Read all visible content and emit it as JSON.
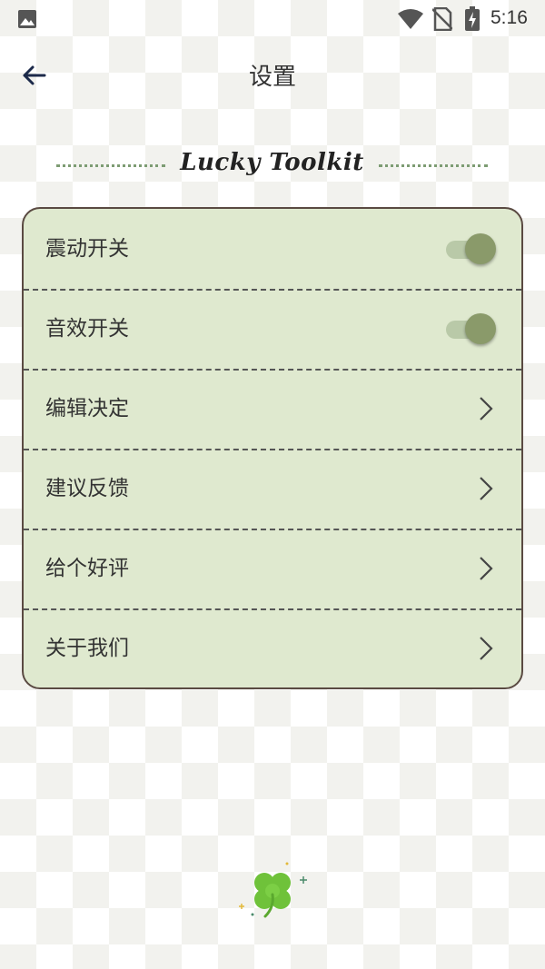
{
  "status_bar": {
    "time": "5:16",
    "icons": [
      "gallery-icon",
      "wifi-icon",
      "no-sim-icon",
      "battery-charging-icon"
    ]
  },
  "header": {
    "title": "设置",
    "back_icon": "arrow-left-icon"
  },
  "brand": {
    "text": "Lucky Toolkit"
  },
  "settings": {
    "vibration": {
      "label": "震动开关",
      "enabled": true
    },
    "sound": {
      "label": "音效开关",
      "enabled": true
    },
    "edit_decision": {
      "label": "编辑决定"
    },
    "feedback": {
      "label": "建议反馈"
    },
    "rate": {
      "label": "给个好评"
    },
    "about": {
      "label": "关于我们"
    }
  },
  "colors": {
    "card_bg": "#dfe9cf",
    "card_border": "#5a4a42",
    "toggle_thumb": "#8a9a6a",
    "toggle_track": "#b9c9a8",
    "clover": "#6fc23a",
    "accent_dots": "#7d9c73"
  }
}
